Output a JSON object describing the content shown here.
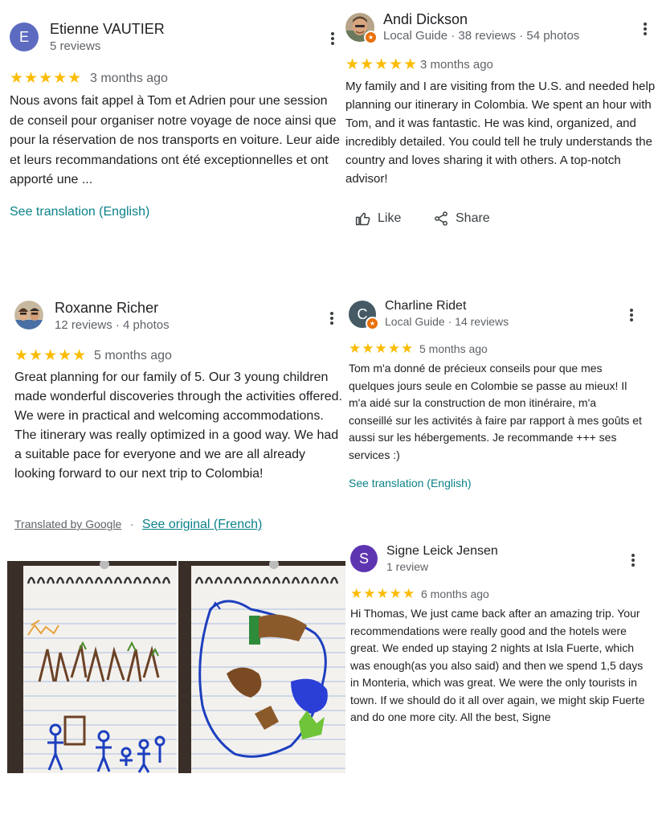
{
  "reviews": {
    "etienne": {
      "avatar_letter": "E",
      "avatar_color": "#5c6bc0",
      "name": "Etienne VAUTIER",
      "meta": "5 reviews",
      "stars": "★★★★★",
      "date": "3 months ago",
      "text": "Nous avons fait appel à Tom et Adrien pour une session de conseil pour organiser notre voyage de noce ainsi que pour la réservation de nos transports en voiture. Leur aide et leurs recommandations ont été exceptionnelles et ont apporté une ...",
      "translate_link": "See translation (English)"
    },
    "andi": {
      "name": "Andi Dickson",
      "meta": "Local Guide · 38 reviews · 54 photos",
      "stars": "★★★★★",
      "date": "3 months ago",
      "text": "My family and I are visiting from the U.S. and needed help planning our itinerary in Colombia. We spent an hour with Tom, and it was fantastic. He was kind, organized, and incredibly detailed. You could tell he truly understands the country and loves sharing it with others. A top-notch advisor!",
      "like_label": "Like",
      "share_label": "Share"
    },
    "roxanne": {
      "name": "Roxanne Richer",
      "meta": "12 reviews · 4 photos",
      "stars": "★★★★★",
      "date": "5 months ago",
      "text": "Great planning for our family of 5. Our 3 young children made wonderful discoveries through the activities offered. We were in practical and welcoming accommodations. The itinerary was really optimized in a good way. We had a suitable pace for everyone and we are all already looking forward to our next trip to Colombia!",
      "translated_by": "Translated by Google",
      "separator": "·",
      "see_original": "See original (French)"
    },
    "charline": {
      "avatar_letter": "C",
      "avatar_color": "#455a64",
      "name": "Charline Ridet",
      "meta": "Local Guide · 14 reviews",
      "stars": "★★★★★",
      "date": "5 months ago",
      "text": "Tom m'a donné de précieux conseils pour que mes quelques jours seule en Colombie se passe au mieux! Il m'a aidé sur la construction de mon itinéraire, m'a conseillé sur les activités à faire par rapport à mes goûts et aussi sur les hébergements. Je recommande +++ ses services :)",
      "translate_link": "See translation (English)"
    },
    "signe": {
      "avatar_letter": "S",
      "avatar_color": "#5e35b1",
      "name": "Signe Leick Jensen",
      "meta": "1 review",
      "stars": "★★★★★",
      "date": "6 months ago",
      "text": "Hi Thomas, We just came back after an amazing trip. Your recommendations were really good and the hotels were great. We ended up staying 2 nights at Isla Fuerte, which was enough(as you also said) and then we spend 1,5 days in Monteria, which was great. We were the only tourists in town. If we should do it all over again, we might skip Fuerte and do one more city. All the best, Signe"
    }
  },
  "photos": {
    "left_caption": "children's drawing of people and trees",
    "right_caption": "children's drawing of animals and a map"
  }
}
